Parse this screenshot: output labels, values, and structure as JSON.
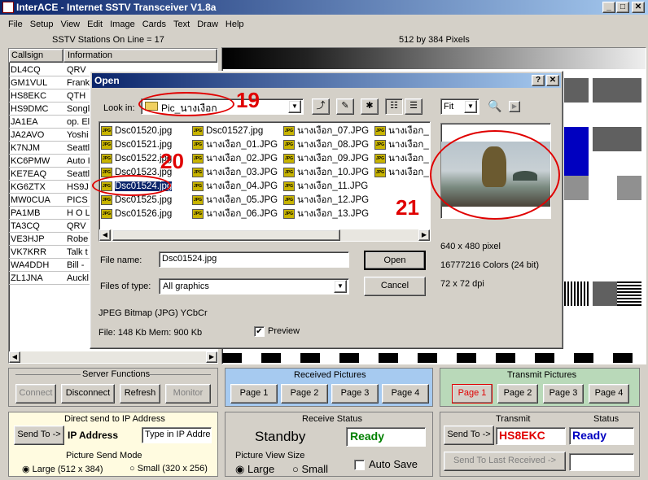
{
  "window": {
    "title": "InterACE - Internet SSTV Transceiver V1.8a"
  },
  "menu": [
    "File",
    "Setup",
    "View",
    "Edit",
    "Image",
    "Cards",
    "Text",
    "Draw",
    "Help"
  ],
  "stations": {
    "header": "SSTV Stations On Line = 17",
    "columns": [
      "Callsign",
      "Information"
    ],
    "rows": [
      {
        "call": "DL4CQ",
        "info": "QRV"
      },
      {
        "call": "GM1VUL",
        "info": "Frank"
      },
      {
        "call": "HS8EKC",
        "info": "QTH"
      },
      {
        "call": "HS9DMC",
        "info": "Songl"
      },
      {
        "call": "JA1EA",
        "info": "op. El"
      },
      {
        "call": "JA2AVO",
        "info": "Yoshi"
      },
      {
        "call": "K7NJM",
        "info": "Seattl"
      },
      {
        "call": "KC6PMW",
        "info": "Auto I"
      },
      {
        "call": "KE7EAQ",
        "info": "Seattl"
      },
      {
        "call": "KG6ZTX",
        "info": "HS9J"
      },
      {
        "call": "MW0CUA",
        "info": "PICS"
      },
      {
        "call": "PA1MB",
        "info": "H O L"
      },
      {
        "call": "TA3CQ",
        "info": "QRV"
      },
      {
        "call": "VE3HJP",
        "info": "Robe"
      },
      {
        "call": "VK7KRR",
        "info": "Talk t"
      },
      {
        "call": "WA4DDH",
        "info": "Bill -"
      },
      {
        "call": "ZL1JNA",
        "info": "Auckl"
      }
    ]
  },
  "image_header": "512 by 384 Pixels",
  "dialog": {
    "title": "Open",
    "help_btn": "?",
    "close_btn": "✕",
    "look_in_label": "Look in:",
    "look_in_value": "Pic_นางเงือก",
    "zoom_value": "Fit",
    "files": [
      "Dsc01520.jpg",
      "Dsc01521.jpg",
      "Dsc01522.jpg",
      "Dsc01523.jpg",
      "Dsc01524.jpg",
      "Dsc01525.jpg",
      "Dsc01526.jpg",
      "Dsc01527.jpg",
      "นางเงือก_01.JPG",
      "นางเงือก_02.JPG",
      "นางเงือก_03.JPG",
      "นางเงือก_04.JPG",
      "นางเงือก_05.JPG",
      "นางเงือก_06.JPG",
      "นางเงือก_07.JPG",
      "นางเงือก_08.JPG",
      "นางเงือก_09.JPG",
      "นางเงือก_10.JPG",
      "นางเงือก_11.JPG",
      "นางเงือก_12.JPG",
      "นางเงือก_13.JPG",
      "นางเงือก_",
      "นางเงือก_",
      "นางเงือก_",
      "นางเงือก_"
    ],
    "file_name_label": "File name:",
    "file_name_value": "Dsc01524.jpg",
    "file_type_label": "Files of type:",
    "file_type_value": "All graphics",
    "open_btn": "Open",
    "cancel_btn": "Cancel",
    "format_info": "JPEG Bitmap (JPG) YCbCr",
    "file_info": "File: 148 Kb   Mem: 900 Kb",
    "preview_label": "Preview",
    "pixel_info": "640 x 480 pixel",
    "color_info": "16777216 Colors (24 bit)",
    "dpi_info": "72 x 72 dpi",
    "icon_label": "JPG"
  },
  "annotations": [
    "19",
    "20",
    "21"
  ],
  "server": {
    "title": "Server Functions",
    "buttons": [
      "Connect",
      "Disconnect",
      "Refresh",
      "Monitor"
    ]
  },
  "received": {
    "title": "Received Pictures",
    "pages": [
      "Page 1",
      "Page 2",
      "Page 3",
      "Page 4"
    ]
  },
  "transmit_pics": {
    "title": "Transmit Pictures",
    "pages": [
      "Page 1",
      "Page 2",
      "Page 3",
      "Page 4"
    ]
  },
  "direct": {
    "title": "Direct send to IP Address",
    "send_btn": "Send To ->",
    "ip_label": "IP Address",
    "ip_placeholder": "Type in IP Address",
    "mode_title": "Picture Send Mode",
    "mode_large": "Large (512 x 384)",
    "mode_small": "Small (320 x 256)"
  },
  "receive_status": {
    "title": "Receive Status",
    "state": "Standby",
    "ready": "Ready",
    "view_title": "Picture View Size",
    "view_large": "Large",
    "view_small": "Small",
    "auto_save": "Auto Save"
  },
  "transmit": {
    "title": "Transmit",
    "status_title": "Status",
    "send_btn": "Send To ->",
    "callsign": "HS8EKC",
    "status": "Ready",
    "send_last_btn": "Send To  Last Received ->"
  },
  "colors": {
    "title_start": "#0a246a",
    "title_end": "#a6caf0",
    "received_bg": "#a6caf0",
    "transmit_bg": "#b9d9b9",
    "direct_bg": "#fffbe0",
    "red": "#e00000",
    "green": "#008000",
    "blue": "#0000c0"
  }
}
